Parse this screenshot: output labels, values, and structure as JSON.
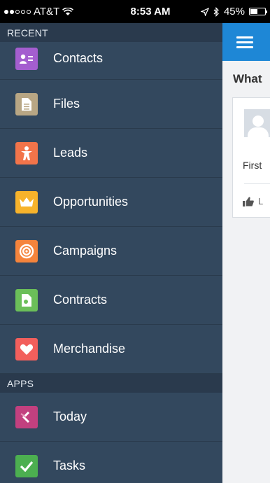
{
  "status_bar": {
    "carrier": "AT&T",
    "time": "8:53 AM",
    "battery": "45%",
    "battery_level": 0.45
  },
  "menu": {
    "sections": [
      {
        "title": "RECENT",
        "items": [
          {
            "label": "Contacts",
            "icon": "contacts-icon",
            "color": "#a45ecf"
          },
          {
            "label": "Files",
            "icon": "file-icon",
            "color": "#b8a684"
          },
          {
            "label": "Leads",
            "icon": "person-icon",
            "color": "#f2744a"
          },
          {
            "label": "Opportunities",
            "icon": "crown-icon",
            "color": "#f7b32b"
          },
          {
            "label": "Campaigns",
            "icon": "target-icon",
            "color": "#f5843c"
          },
          {
            "label": "Contracts",
            "icon": "contract-icon",
            "color": "#6bbf59"
          },
          {
            "label": "Merchandise",
            "icon": "heart-icon",
            "color": "#f25f5c"
          }
        ]
      },
      {
        "title": "APPS",
        "items": [
          {
            "label": "Today",
            "icon": "today-icon",
            "color": "#c2407f"
          },
          {
            "label": "Tasks",
            "icon": "check-icon",
            "color": "#4caf50"
          }
        ]
      }
    ]
  },
  "panel": {
    "title": "What",
    "card_text": "First",
    "like_label": "L"
  },
  "colors": {
    "menu_bg": "#33485e",
    "header_bg": "#2a3a4d",
    "accent": "#1e87d6"
  }
}
